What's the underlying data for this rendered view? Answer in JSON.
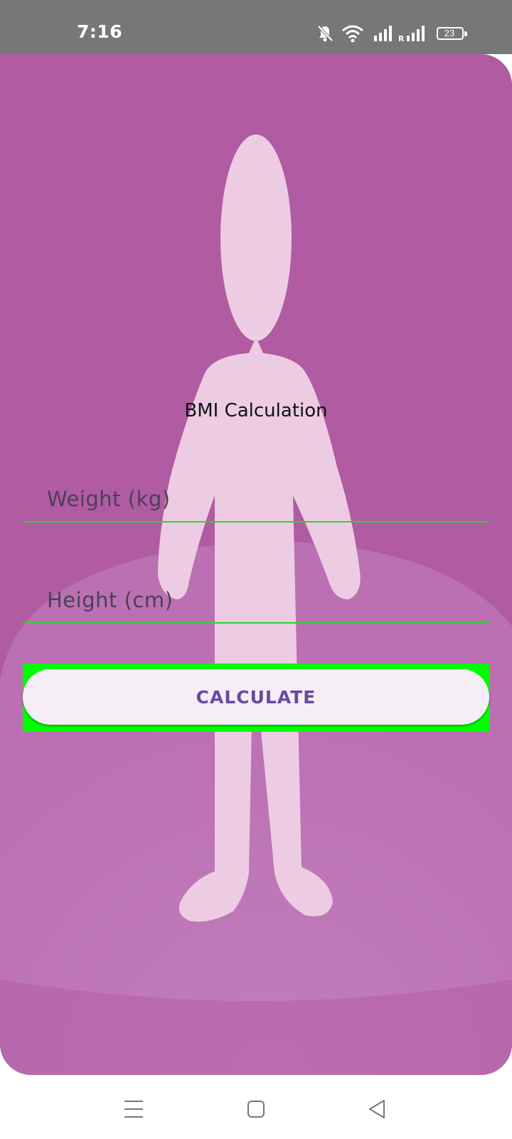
{
  "status_bar": {
    "time": "7:16",
    "battery_level": "23",
    "icons": [
      "bell-off-icon",
      "wifi-icon",
      "signal-icon",
      "roaming-signal-icon",
      "battery-icon"
    ]
  },
  "app": {
    "title": "BMI Calculation",
    "weight_field": {
      "placeholder": "Weight (kg)",
      "value": ""
    },
    "height_field": {
      "placeholder": "Height (cm)",
      "value": ""
    },
    "calculate_button": "CALCULATE",
    "colors": {
      "background": "#b15ca3",
      "figure": "#f5dcec",
      "underline": "#2dd42d",
      "button_highlight": "#00ff00",
      "button_text": "#6a4aa0"
    }
  },
  "nav_bar": {
    "icons": [
      "menu-icon",
      "home-icon",
      "back-icon"
    ]
  }
}
